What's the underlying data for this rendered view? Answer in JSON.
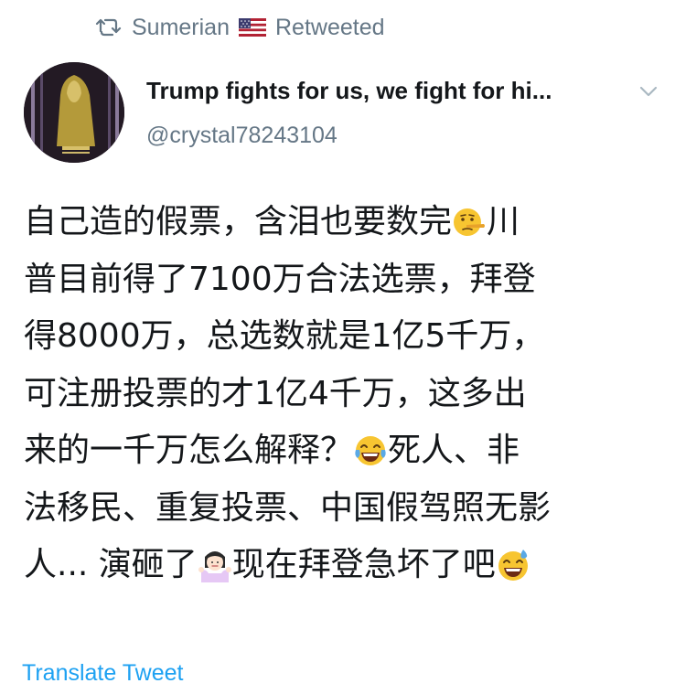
{
  "retweet": {
    "icon": "retweet-icon",
    "retweeter": "Sumerian",
    "flag": "us-flag-icon",
    "label": "Retweeted"
  },
  "author": {
    "display_name": "Trump fights for us, we fight for hi...",
    "handle": "@crystal78243104",
    "avatar": "avatar-image"
  },
  "tweet": {
    "lines": [
      {
        "a": "自己造的假票，含泪也要数完",
        "emoji": "lying-face-emoji",
        "b": "川"
      },
      {
        "text": "普目前得了7100万合法选票，拜登"
      },
      {
        "text": "得8000万，总选数就是1亿5千万，"
      },
      {
        "text": "可注册投票的才1亿4千万，这多出"
      },
      {
        "a": "来的一千万怎么解释？",
        "emoji": "tears-of-joy-emoji",
        "b": "死人、非"
      },
      {
        "text": "法移民、重复投票、中国假驾照无影"
      },
      {
        "a": "人... 演砸了",
        "emoji": "person-shrugging-emoji",
        "b": "现在拜登急坏了吧",
        "emoji2": "grinning-sweat-emoji"
      }
    ]
  },
  "actions": {
    "translate_label": "Translate Tweet"
  },
  "colors": {
    "text": "#14171a",
    "secondary": "#657786",
    "link": "#1da1f2"
  }
}
